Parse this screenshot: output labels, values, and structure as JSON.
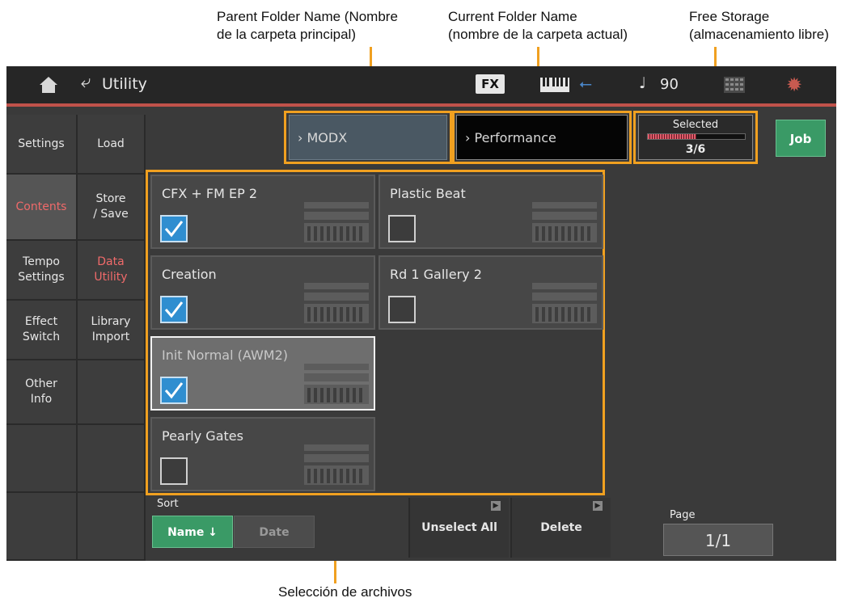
{
  "annotations": {
    "parent_folder": [
      "Parent Folder Name (Nombre",
      "de la carpeta principal)"
    ],
    "current_folder": [
      "Current Folder Name",
      "(nombre de la carpeta actual)"
    ],
    "free_storage": [
      "Free Storage",
      "(almacenamiento libre)"
    ],
    "file_selection": "Selección de archivos",
    "callout_color": "#f0a020"
  },
  "header": {
    "title": "Utility",
    "fx_label": "FX",
    "tempo": "90",
    "tempo_icon": "quarter-note-icon",
    "accent_color": "#c0524a",
    "icons": [
      "home-icon",
      "back-icon",
      "keyboard-icon",
      "usb-icon",
      "grid-icon",
      "gear-icon"
    ]
  },
  "sidebar": {
    "column1": [
      {
        "label": "Settings"
      },
      {
        "label": "Contents",
        "active": true
      },
      {
        "label": "Tempo\nSettings"
      },
      {
        "label": "Effect\nSwitch"
      },
      {
        "label": "Other\nInfo"
      }
    ],
    "column2": [
      {
        "label": "Load"
      },
      {
        "label": "Store\n/ Save"
      },
      {
        "label": "Data\nUtility",
        "current": true
      },
      {
        "label": "Library\nImport"
      }
    ]
  },
  "folders": {
    "parent": "MODX",
    "current": "Performance"
  },
  "storage": {
    "label": "Selected",
    "count": "3/6",
    "fill_fraction": 0.5
  },
  "job_label": "Job",
  "files": [
    {
      "name": "CFX + FM EP 2",
      "checked": true
    },
    {
      "name": "Plastic Beat",
      "checked": false
    },
    {
      "name": "Creation",
      "checked": true
    },
    {
      "name": "Rd 1 Gallery 2",
      "checked": false
    },
    {
      "name": "Init Normal (AWM2)",
      "checked": true,
      "selected": true
    },
    {
      "name": "Pearly Gates",
      "checked": false
    }
  ],
  "sort": {
    "label": "Sort",
    "name_option": "Name ↓",
    "date_option": "Date",
    "active": "name"
  },
  "buttons": {
    "unselect_all": "Unselect All",
    "delete": "Delete"
  },
  "page": {
    "label": "Page",
    "value": "1/1"
  },
  "colors": {
    "checkbox_on": "#2f8ed0",
    "green_button": "#3a9a66",
    "active_tab_text": "#ef6a6a"
  }
}
